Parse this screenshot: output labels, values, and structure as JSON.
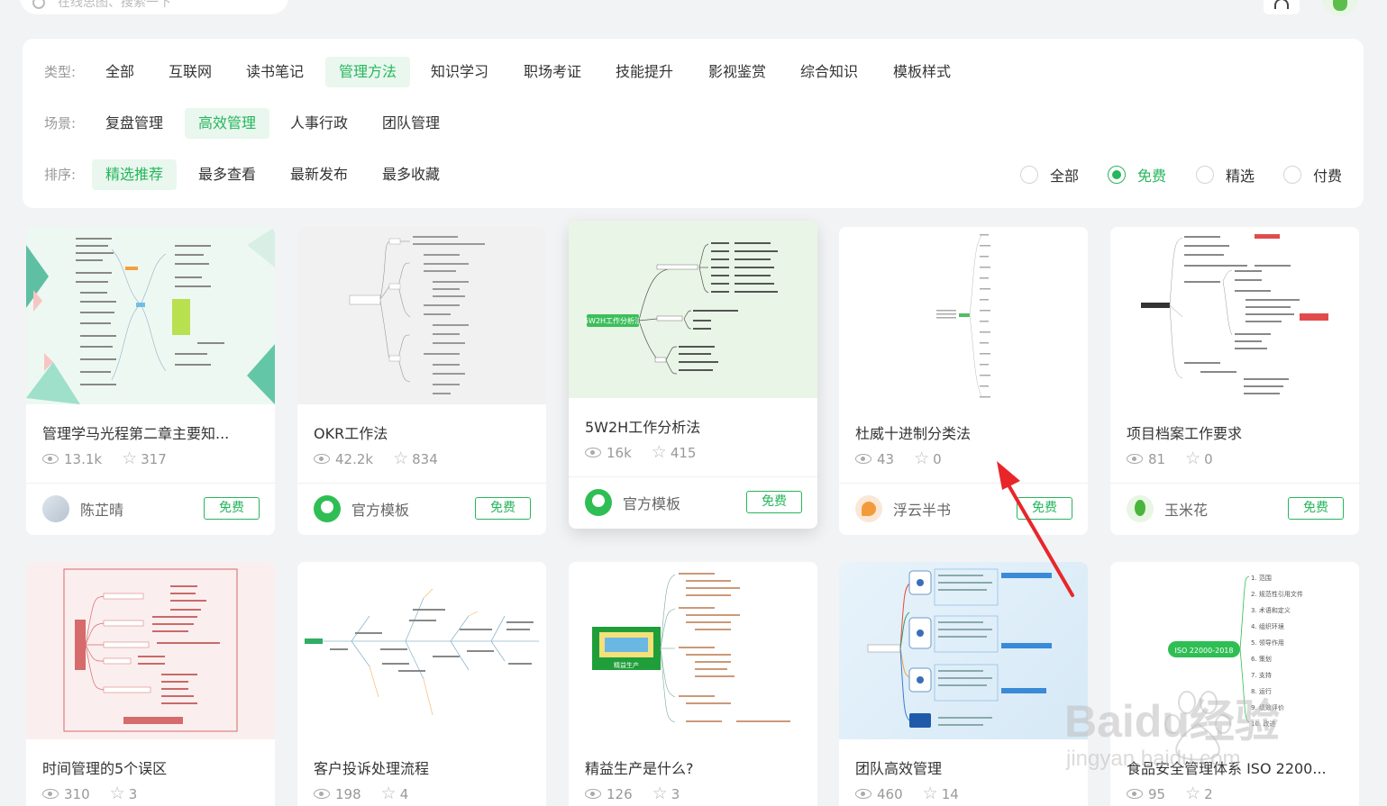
{
  "search": {
    "placeholder": "在线思图、搜索一下"
  },
  "filters": {
    "type_label": "类型:",
    "types": [
      "全部",
      "互联网",
      "读书笔记",
      "管理方法",
      "知识学习",
      "职场考证",
      "技能提升",
      "影视鉴赏",
      "综合知识",
      "模板样式"
    ],
    "scene_label": "场景:",
    "scenes": [
      "复盘管理",
      "高效管理",
      "人事行政",
      "团队管理"
    ],
    "sort_label": "排序:",
    "sorts": [
      "精选推荐",
      "最多查看",
      "最新发布",
      "最多收藏"
    ],
    "price_options": [
      "全部",
      "免费",
      "精选",
      "付费"
    ]
  },
  "cards": [
    {
      "title": "管理学马光程第二章主要知...",
      "views": "13.1k",
      "stars": "317",
      "author": "陈芷晴",
      "badge": "免费"
    },
    {
      "title": "OKR工作法",
      "views": "42.2k",
      "stars": "834",
      "author": "官方模板",
      "badge": "免费"
    },
    {
      "title": "5W2H工作分析法",
      "views": "16k",
      "stars": "415",
      "author": "官方模板",
      "badge": "免费",
      "thumb_label": "5W2H工作分析法"
    },
    {
      "title": "杜威十进制分类法",
      "views": "43",
      "stars": "0",
      "author": "浮云半书",
      "badge": "免费"
    },
    {
      "title": "项目档案工作要求",
      "views": "81",
      "stars": "0",
      "author": "玉米花",
      "badge": "免费"
    },
    {
      "title": "时间管理的5个误区",
      "views": "310",
      "stars": "3"
    },
    {
      "title": "客户投诉处理流程",
      "views": "198",
      "stars": "4"
    },
    {
      "title": "精益生产是什么?",
      "views": "126",
      "stars": "3",
      "thumb_label": "精益生产"
    },
    {
      "title": "团队高效管理",
      "views": "460",
      "stars": "14"
    },
    {
      "title": "食品安全管理体系 ISO 2200...",
      "views": "95",
      "stars": "2",
      "thumb_label": "ISO 22000-2018",
      "thumb_items": [
        "1. 范围",
        "2. 规范性引用文件",
        "3. 术语和定义",
        "4. 组织环境",
        "5. 领导作用",
        "6. 策划",
        "7. 支持",
        "8. 运行",
        "9. 绩效评价",
        "10. 改进"
      ]
    }
  ],
  "watermark": {
    "text": "Baidu经验",
    "url_text": "jingyan.baidu.com"
  },
  "colors": {
    "accent": "#26b65c",
    "accent_bg": "#e9f7ee",
    "arrow": "#e8262a"
  },
  "active": {
    "type": "管理方法",
    "scene": "高效管理",
    "sort": "精选推荐",
    "price": "免费"
  }
}
